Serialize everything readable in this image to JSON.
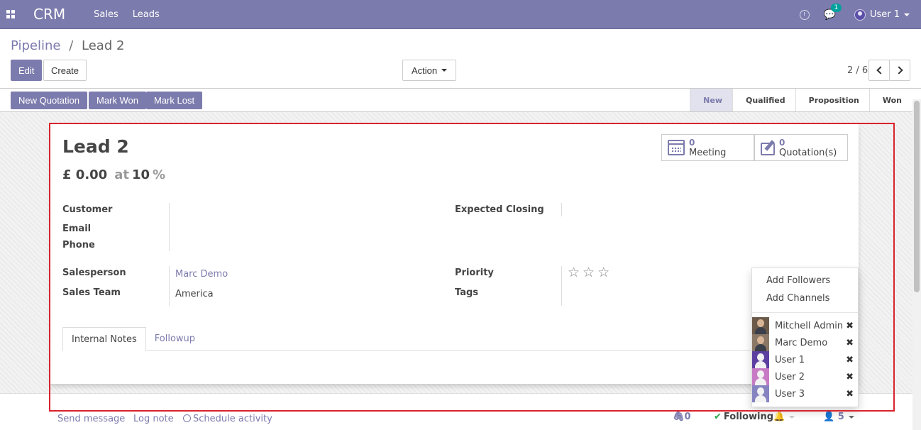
{
  "navbar": {
    "app_name": "CRM",
    "menus": [
      "Sales",
      "Leads"
    ],
    "message_count": "1",
    "user_name": "User 1",
    "color": "#7c7bad"
  },
  "control_panel": {
    "breadcrumb_parent": "Pipeline",
    "breadcrumb_sep": "/",
    "breadcrumb_current": "Lead 2",
    "edit_label": "Edit",
    "create_label": "Create",
    "action_label": "Action",
    "pager": "2 / 6"
  },
  "statusbar": {
    "buttons": [
      "New Quotation",
      "Mark Won",
      "Mark Lost"
    ],
    "stages": [
      "New",
      "Qualified",
      "Proposition",
      "Won"
    ],
    "active_stage": "New"
  },
  "form": {
    "title": "Lead 2",
    "revenue": "£ 0.00",
    "at_label": "at",
    "probability": "10",
    "percent": "%",
    "stat_buttons": [
      {
        "value": "0",
        "label": "Meeting",
        "icon": "calendar-icon"
      },
      {
        "value": "0",
        "label": "Quotation(s)",
        "icon": "pencil-square-icon"
      }
    ],
    "labels": {
      "customer": "Customer",
      "email": "Email",
      "phone": "Phone",
      "expected_closing": "Expected Closing",
      "salesperson": "Salesperson",
      "sales_team": "Sales Team",
      "priority": "Priority",
      "tags": "Tags"
    },
    "values": {
      "salesperson": "Marc Demo",
      "sales_team": "America"
    },
    "priority_stars": [
      "☆",
      "☆",
      "☆"
    ],
    "tabs": [
      "Internal Notes",
      "Followup"
    ]
  },
  "chatter": {
    "send_message": "Send message",
    "log_note": "Log note",
    "schedule_activity": "Schedule activity",
    "attachments": "0",
    "following": "Following",
    "followers_count": "5"
  },
  "followers_dropdown": {
    "add_followers": "Add Followers",
    "add_channels": "Add Channels",
    "followers": [
      {
        "name": "Mitchell Admin",
        "avatar_color": "#6b5a4a"
      },
      {
        "name": "Marc Demo",
        "avatar_color": "#8a7766"
      },
      {
        "name": "User 1",
        "avatar_color": "#5c3fa0"
      },
      {
        "name": "User 2",
        "avatar_color": "#c77bc4"
      },
      {
        "name": "User 3",
        "avatar_color": "#8583c0"
      }
    ],
    "remove_glyph": "✖"
  }
}
